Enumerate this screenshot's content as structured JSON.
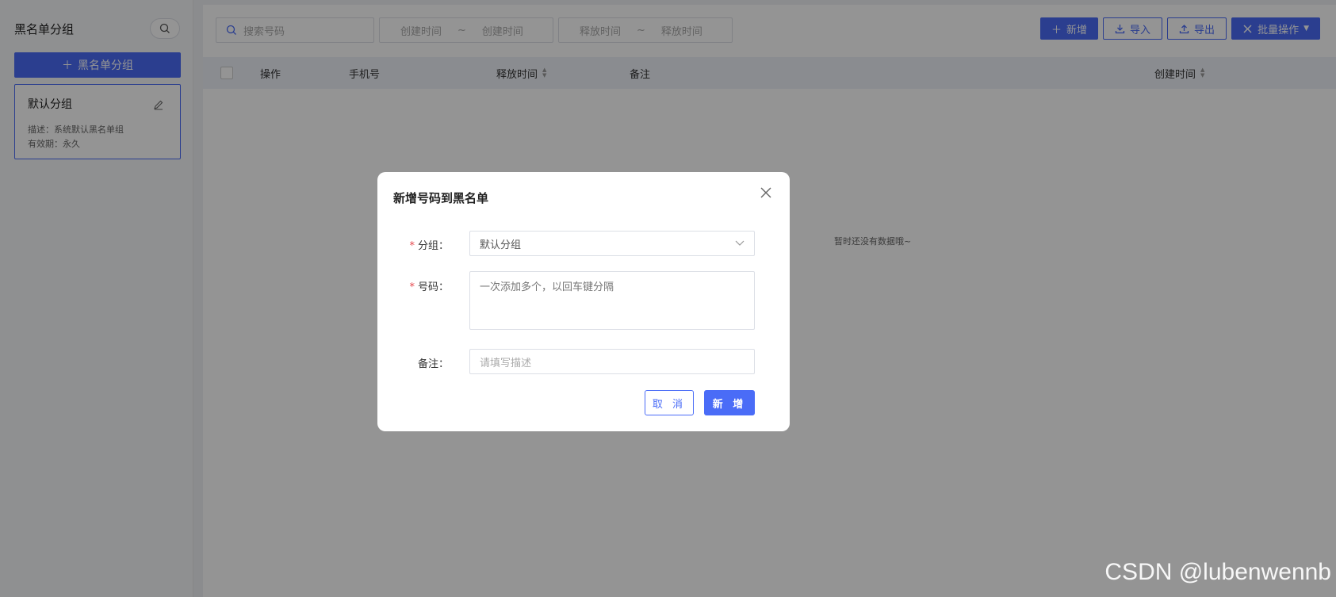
{
  "sidebar": {
    "title": "黑名单分组",
    "add_button": "黑名单分组",
    "group": {
      "name": "默认分组",
      "description": "描述：系统默认黑名单组",
      "validity": "有效期：永久"
    }
  },
  "toolbar": {
    "search_placeholder": "搜索号码",
    "create_range": {
      "start": "创建时间",
      "sep": "~",
      "end": "创建时间"
    },
    "release_range": {
      "start": "释放时间",
      "sep": "~",
      "end": "释放时间"
    },
    "buttons": {
      "add": "新增",
      "import": "导入",
      "export": "导出",
      "batch": "批量操作"
    }
  },
  "table": {
    "columns": [
      "操作",
      "手机号",
      "释放时间",
      "备注",
      "创建时间"
    ],
    "empty_text": "暂时还没有数据哦~"
  },
  "modal": {
    "title": "新增号码到黑名单",
    "group_label": "分组：",
    "group_value": "默认分组",
    "number_label": "号码：",
    "number_placeholder": "一次添加多个，以回车键分隔",
    "remark_label": "备注：",
    "remark_placeholder": "请填写描述",
    "cancel": "取 消",
    "submit": "新 增"
  },
  "watermark": "CSDN @lubenwennb",
  "colors": {
    "primary": "#4a6cf7",
    "required": "#e5484d"
  }
}
